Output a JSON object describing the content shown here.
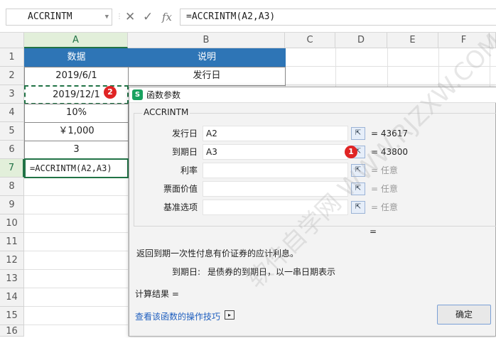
{
  "formula_bar": {
    "name_box": "ACCRINTM",
    "cancel_icon": "close-icon",
    "enter_icon": "check-icon",
    "fx_label": "fx",
    "formula": "=ACCRINTM(A2,A3)"
  },
  "sheet": {
    "columns": [
      "A",
      "B",
      "C",
      "D",
      "E",
      "F"
    ],
    "rows": [
      "1",
      "2",
      "3",
      "4",
      "5",
      "6",
      "7",
      "8",
      "9",
      "10",
      "11",
      "12",
      "13",
      "14",
      "15",
      "16"
    ],
    "headers": [
      "数据",
      "说明"
    ],
    "a_values": [
      "2019/6/1",
      "2019/12/1",
      "10%",
      "￥1,000",
      "3",
      "=ACCRINTM(A2,A3)"
    ],
    "b_values": [
      "发行日"
    ],
    "colors": {
      "header_fill": "#2e75b6",
      "selected_green": "#217346"
    }
  },
  "dialog": {
    "title": "函数参数",
    "function_name": "ACCRINTM",
    "params": [
      {
        "label": "发行日",
        "input": "A2",
        "result": "= 43617"
      },
      {
        "label": "到期日",
        "input": "A3",
        "result": "= 43800"
      },
      {
        "label": "利率",
        "input": "",
        "result": "= 任意"
      },
      {
        "label": "票面价值",
        "input": "",
        "result": "= 任意"
      },
      {
        "label": "基准选项",
        "input": "",
        "result": "= 任意"
      }
    ],
    "total_eq": "=",
    "description": "返回到期一次性付息有价证券的应计利息。",
    "param_help_label": "到期日:",
    "param_help_text": "是债券的到期日，以一串日期表示",
    "calc_result_label": "计算结果  =",
    "help_link": "查看该函数的操作技巧",
    "ok_label": "确定"
  },
  "badges": [
    "1",
    "2"
  ],
  "watermark": "软件自学网 WWW.RJZXW.COM"
}
